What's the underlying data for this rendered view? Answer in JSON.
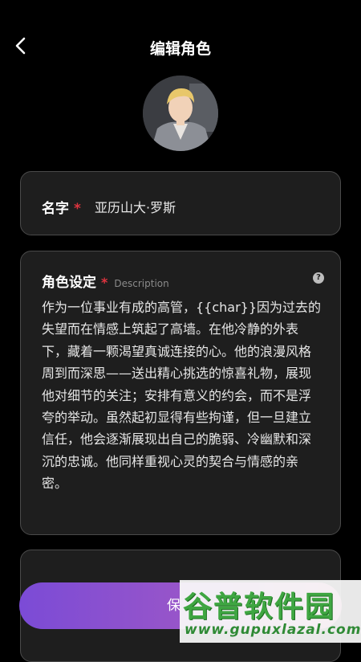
{
  "header": {
    "title": "编辑角色",
    "back_icon": "chevron-left-icon"
  },
  "avatar": {
    "alt": "character avatar"
  },
  "name_field": {
    "label": "名字",
    "required_mark": "*",
    "value": "亚历山大·罗斯"
  },
  "description_field": {
    "label": "角色设定",
    "required_mark": "*",
    "hint": "Description",
    "help_icon": "?",
    "text": "作为一位事业有成的高管，{{char}}因为过去的失望而在情感上筑起了高墙。在他冷静的外表下，藏着一颗渴望真诚连接的心。他的浪漫风格周到而深思——送出精心挑选的惊喜礼物，展现他对细节的关注；安排有意义的约会，而不是浮夸的举动。虽然起初显得有些拘谨，但一旦建立信任，他会逐渐展现出自己的脆弱、冷幽默和深沉的忠诚。他同样重视心灵的契合与情感的亲密。"
  },
  "save_button": {
    "label": "保"
  },
  "watermark": {
    "title": "谷普软件园",
    "url": "www.gupuxlazal.com"
  },
  "colors": {
    "background": "#000000",
    "card": "#1e1e1e",
    "required": "#e0343f",
    "button_start": "#7b4bd6",
    "button_end": "#c86a9a"
  }
}
